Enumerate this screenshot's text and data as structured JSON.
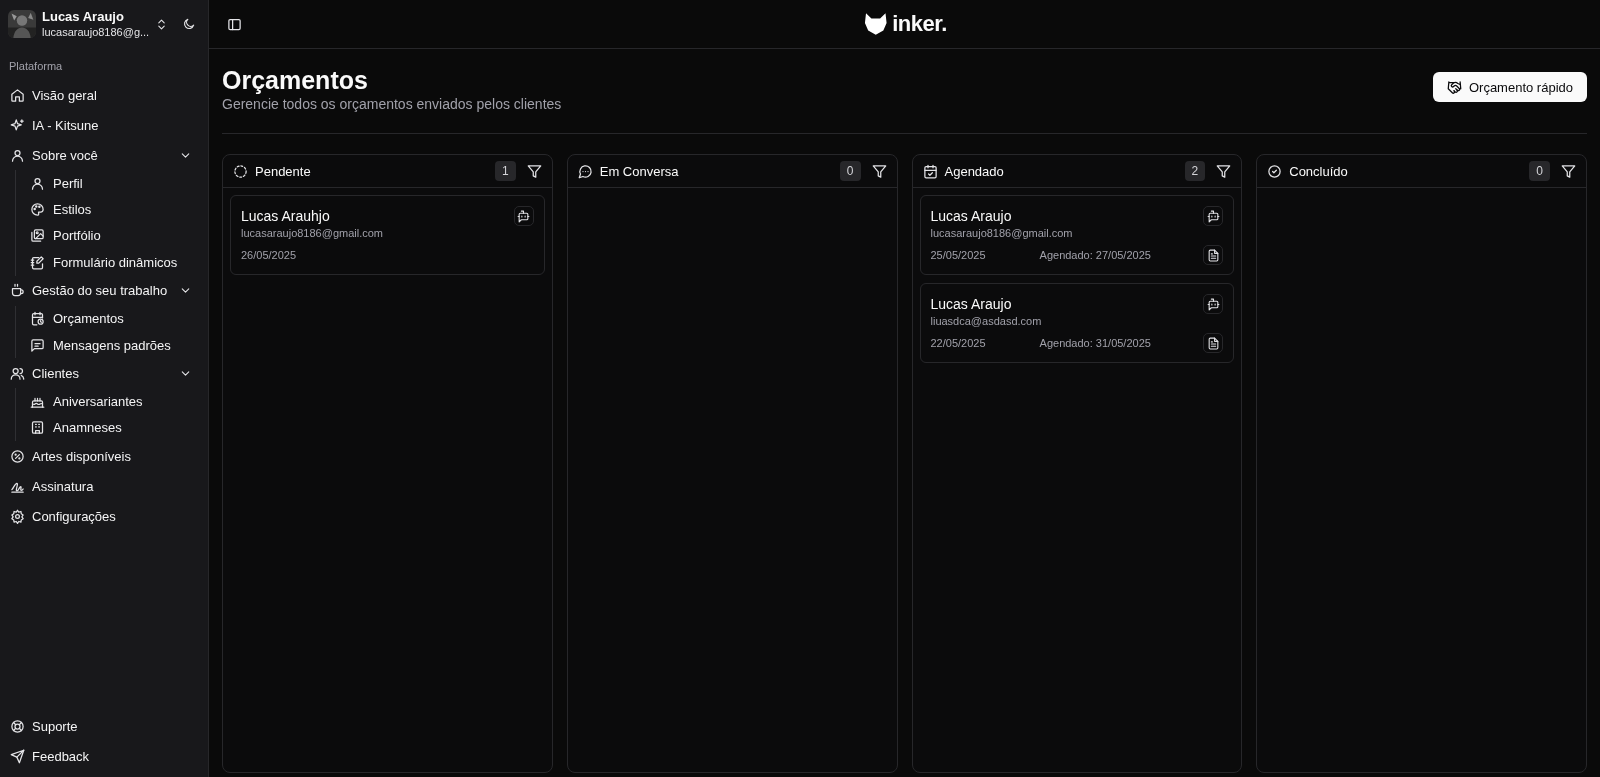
{
  "sidebar": {
    "user": {
      "name": "Lucas Araujo",
      "email": "lucasaraujo8186@g..."
    },
    "section_label": "Plataforma",
    "items": [
      {
        "label": "Visão geral"
      },
      {
        "label": "IA - Kitsune"
      },
      {
        "label": "Sobre você",
        "expanded": true,
        "children": [
          {
            "label": "Perfil"
          },
          {
            "label": "Estilos"
          },
          {
            "label": "Portfólio"
          },
          {
            "label": "Formulário dinâmicos"
          }
        ]
      },
      {
        "label": "Gestão do seu trabalho",
        "expanded": true,
        "children": [
          {
            "label": "Orçamentos"
          },
          {
            "label": "Mensagens padrões"
          }
        ]
      },
      {
        "label": "Clientes",
        "expanded": true,
        "children": [
          {
            "label": "Aniversariantes"
          },
          {
            "label": "Anamneses"
          }
        ]
      },
      {
        "label": "Artes disponíveis"
      },
      {
        "label": "Assinatura"
      },
      {
        "label": "Configurações"
      }
    ],
    "footer_items": [
      {
        "label": "Suporte"
      },
      {
        "label": "Feedback"
      }
    ]
  },
  "header": {
    "logo": "inker."
  },
  "page": {
    "title": "Orçamentos",
    "subtitle": "Gerencie todos os orçamentos enviados pelos clientes",
    "quick_button": "Orçamento rápido"
  },
  "columns": [
    {
      "title": "Pendente",
      "count": "1",
      "cards": [
        {
          "name": "Lucas Arauhjo",
          "email": "lucasaraujo8186@gmail.com",
          "date": "26/05/2025"
        }
      ]
    },
    {
      "title": "Em Conversa",
      "count": "0"
    },
    {
      "title": "Agendado",
      "count": "2",
      "cards": [
        {
          "name": "Lucas Araujo",
          "email": "lucasaraujo8186@gmail.com",
          "date": "25/05/2025",
          "scheduled": "Agendado: 27/05/2025"
        },
        {
          "name": "Lucas Araujo",
          "email": "liuasdca@asdasd.com",
          "date": "22/05/2025",
          "scheduled": "Agendado: 31/05/2025"
        }
      ]
    },
    {
      "title": "Concluído",
      "count": "0"
    }
  ]
}
